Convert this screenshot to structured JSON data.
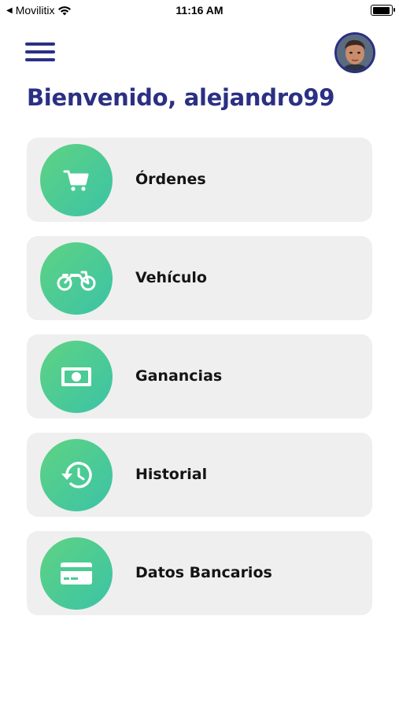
{
  "status_bar": {
    "carrier": "Movilitix",
    "time": "11:16 AM"
  },
  "header": {
    "greeting": "Bienvenido, alejandro99"
  },
  "colors": {
    "brand_navy": "#2b3083",
    "tile_bg": "#efefef",
    "gradient_start": "#5fd383",
    "gradient_end": "#3bc3a6"
  },
  "menu": {
    "items": [
      {
        "label": "Órdenes",
        "icon": "cart-icon"
      },
      {
        "label": "Vehículo",
        "icon": "motorcycle-icon"
      },
      {
        "label": "Ganancias",
        "icon": "money-icon"
      },
      {
        "label": "Historial",
        "icon": "history-icon"
      },
      {
        "label": "Datos Bancarios",
        "icon": "credit-card-icon"
      }
    ]
  }
}
